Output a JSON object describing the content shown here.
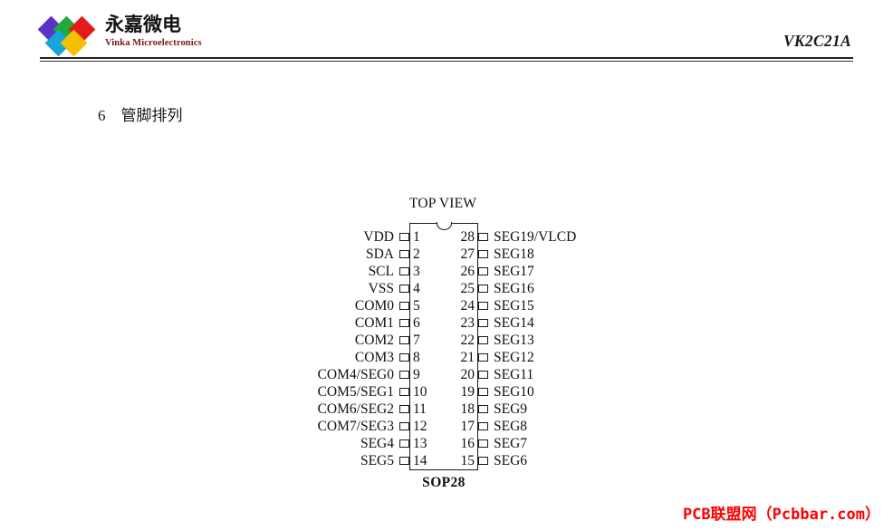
{
  "header": {
    "logo": {
      "name_cn": "永嘉微电",
      "name_en": "Vinka Microelectronics",
      "diamond_colors": [
        "#5b32c8",
        "#1faa3c",
        "#e41a1c",
        "#16a5d8",
        "#f5c000"
      ]
    },
    "document_title": "VK2C21A"
  },
  "section": {
    "number": "6",
    "title": "管脚排列"
  },
  "diagram": {
    "top_label": "TOP VIEW",
    "package_label": "SOP28",
    "left_pins": [
      {
        "num": "1",
        "name": "VDD"
      },
      {
        "num": "2",
        "name": "SDA"
      },
      {
        "num": "3",
        "name": "SCL"
      },
      {
        "num": "4",
        "name": "VSS"
      },
      {
        "num": "5",
        "name": "COM0"
      },
      {
        "num": "6",
        "name": "COM1"
      },
      {
        "num": "7",
        "name": "COM2"
      },
      {
        "num": "8",
        "name": "COM3"
      },
      {
        "num": "9",
        "name": "COM4/SEG0"
      },
      {
        "num": "10",
        "name": "COM5/SEG1"
      },
      {
        "num": "11",
        "name": "COM6/SEG2"
      },
      {
        "num": "12",
        "name": "COM7/SEG3"
      },
      {
        "num": "13",
        "name": "SEG4"
      },
      {
        "num": "14",
        "name": "SEG5"
      }
    ],
    "right_pins": [
      {
        "num": "28",
        "name": "SEG19/VLCD"
      },
      {
        "num": "27",
        "name": "SEG18"
      },
      {
        "num": "26",
        "name": "SEG17"
      },
      {
        "num": "25",
        "name": "SEG16"
      },
      {
        "num": "24",
        "name": "SEG15"
      },
      {
        "num": "23",
        "name": "SEG14"
      },
      {
        "num": "22",
        "name": "SEG13"
      },
      {
        "num": "21",
        "name": "SEG12"
      },
      {
        "num": "20",
        "name": "SEG11"
      },
      {
        "num": "19",
        "name": "SEG10"
      },
      {
        "num": "18",
        "name": "SEG9"
      },
      {
        "num": "17",
        "name": "SEG8"
      },
      {
        "num": "16",
        "name": "SEG7"
      },
      {
        "num": "15",
        "name": "SEG6"
      }
    ]
  },
  "watermark": {
    "text": "PCB联盟网（Pcbbar.com）",
    "color": "#ff0000"
  }
}
